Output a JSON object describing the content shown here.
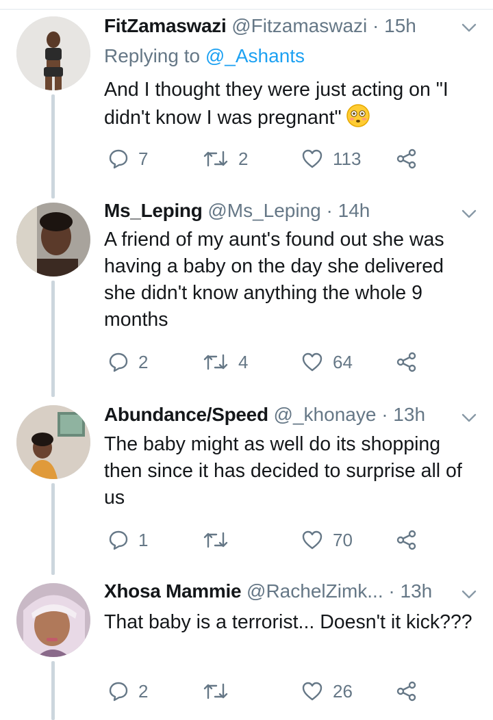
{
  "tweets": [
    {
      "name": "FitZamaswazi",
      "handle": "@Fitzamaswazi",
      "time": "15h",
      "reply_prefix": "Replying to",
      "reply_to": "@_Ashants",
      "text": "And I thought they were just acting on \"I didn't know I was pregnant\"",
      "emoji_icon": "flushed-face-emoji",
      "replies": "7",
      "retweets": "2",
      "likes": "113"
    },
    {
      "name": "Ms_Leping",
      "handle": "@Ms_Leping",
      "time": "14h",
      "text": "A friend of my aunt's found out she was having a baby on the day she delivered she didn't know anything the whole 9 months",
      "replies": "2",
      "retweets": "4",
      "likes": "64"
    },
    {
      "name": "Abundance/Speed",
      "handle": "@_khonaye",
      "time": "13h",
      "text": "The baby might as well do its shopping then since it has decided to surprise all of us",
      "replies": "1",
      "retweets": "",
      "likes": "70"
    },
    {
      "name": "Xhosa Mammie",
      "handle": "@RachelZimk...",
      "time": "13h",
      "text": "That baby is a terrorist... Doesn't it kick???",
      "replies": "2",
      "retweets": "",
      "likes": "26"
    }
  ],
  "separator": "·",
  "colors": {
    "accent": "#1da1f2",
    "muted": "#657786",
    "text": "#14171a",
    "thread_line": "#ccd6dd"
  }
}
